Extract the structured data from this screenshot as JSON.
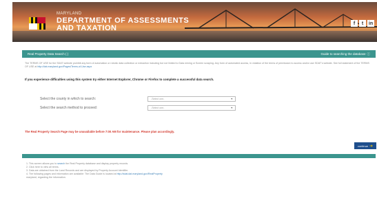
{
  "header": {
    "state": "MARYLAND",
    "department_line1": "DEPARTMENT OF ASSESSMENTS",
    "department_line2": "AND TAXATION",
    "social_icons": [
      "facebook-icon",
      "twitter-icon",
      "linkedin-icon"
    ],
    "social_glyphs": [
      "f",
      "t",
      "in"
    ]
  },
  "titlebar": {
    "title": "Real Property Data Search ( )",
    "guide_link": "Guide to searching the database"
  },
  "disclaimer": {
    "text": "The TERMS OF USE for the SDAT website prohibit any form of automation or robotic data collection or extraction including but not limited to Data mining or Screen scraping. Any form of automated access, in violation of the",
    "text2": "terms of permission to access and/or use SDAT's website. See full statement of the TERMS OF USE at",
    "link": "http://dat.maryland.gov/Pages/Terms-of-Use.aspx"
  },
  "trouble": "If you experience difficulties using this system try either Internet Explorer, Chrome or Firefox to complete a successful data search.",
  "form": {
    "county_label": "Select the county in which to search:",
    "county_value": "-Select one-",
    "method_label": "Select the search method to proceed:",
    "method_value": "-Select one-"
  },
  "warning": "The Real Property Search Page may be unavailable before 7:00 AM for maintenance. Please plan accordingly.",
  "continue_label": "continue",
  "notes": [
    {
      "pre": "1. This screen allows you to ",
      "link": "search",
      "post": " the Real Property database and display property records."
    },
    {
      "pre": "2. Click here to view all terms.",
      "link": "",
      "post": ""
    },
    {
      "pre": "3. Data are obtained from the Land Records and are displayed by Property Account Identifier.",
      "link": "",
      "post": ""
    },
    {
      "pre": "4. The following pages and information are available: The Data Guide is located at ",
      "link": "http://sdat.dat.maryland.gov/RealProperty",
      "post": ""
    },
    {
      "pre": "   maryland, regarding the information.",
      "link": "",
      "post": ""
    }
  ]
}
